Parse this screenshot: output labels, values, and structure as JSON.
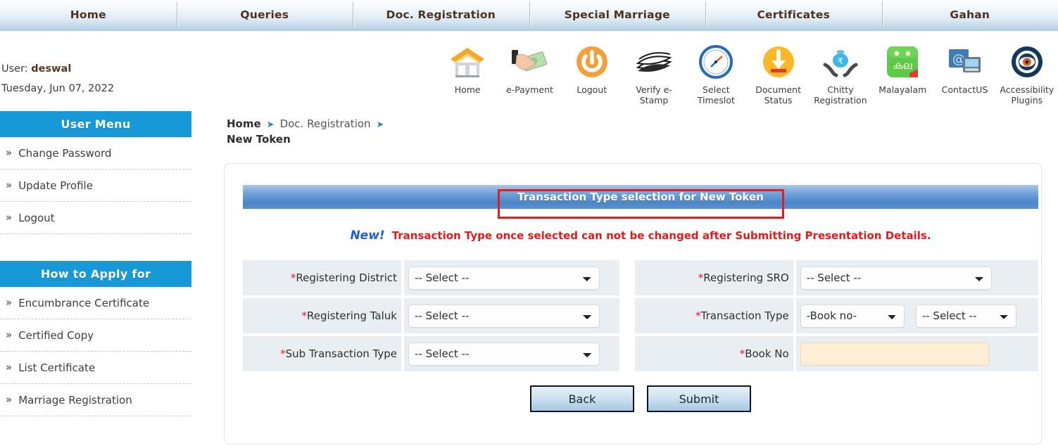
{
  "topnav": {
    "items": [
      {
        "label": "Home"
      },
      {
        "label": "Queries"
      },
      {
        "label": "Doc. Registration"
      },
      {
        "label": "Special Marriage"
      },
      {
        "label": "Certificates"
      },
      {
        "label": "Gahan"
      }
    ]
  },
  "user": {
    "prefix": "User:",
    "name": "deswal",
    "date": "Tuesday, Jun 07, 2022"
  },
  "sidebar": {
    "user_menu_title": "User Menu",
    "user_menu_items": [
      {
        "label": "Change Password"
      },
      {
        "label": "Update Profile"
      },
      {
        "label": "Logout"
      }
    ],
    "apply_title": "How to Apply for",
    "apply_items": [
      {
        "label": "Encumbrance Certificate"
      },
      {
        "label": "Certified Copy"
      },
      {
        "label": "List Certificate"
      },
      {
        "label": "Marriage Registration"
      }
    ]
  },
  "iconbar": {
    "items": [
      {
        "label": "Home",
        "icon": "house-icon"
      },
      {
        "label": "e-Payment",
        "icon": "hand-cash-icon"
      },
      {
        "label": "Logout",
        "icon": "power-icon"
      },
      {
        "label": "Verify e-Stamp",
        "icon": "stack-paper-icon"
      },
      {
        "label": "Select Timeslot",
        "icon": "clock-icon"
      },
      {
        "label": "Document Status",
        "icon": "download-circle-icon"
      },
      {
        "label": "Chitty Registration",
        "icon": "money-bag-hands-icon"
      },
      {
        "label": "Malayalam",
        "icon": "malayalam-app-icon"
      },
      {
        "label": "ContactUS",
        "icon": "at-mail-icon"
      },
      {
        "label": "Accessibility Plugins",
        "icon": "eye-target-icon"
      }
    ]
  },
  "breadcrumb": {
    "home": "Home",
    "section": "Doc.  Registration",
    "current": "New Token",
    "arrow": "➤"
  },
  "panel": {
    "header_title": "Transaction Type selection for New Token",
    "notice_new": "New!",
    "notice_message": "Transaction Type once selected can not be changed after Submitting Presentation Details.",
    "fields": {
      "registering_district": {
        "label": "Registering District",
        "required": "*",
        "value": "-- Select --",
        "options": [
          "-- Select --"
        ]
      },
      "registering_sro": {
        "label": "Registering SRO",
        "required": "*",
        "value": "-- Select --",
        "options": [
          "-- Select --"
        ]
      },
      "registering_taluk": {
        "label": "Registering Taluk",
        "required": "*",
        "value": "-- Select --",
        "options": [
          "-- Select --"
        ]
      },
      "transaction_type": {
        "label": "Transaction Type",
        "required": "*",
        "book_value": "-Book no-",
        "book_options": [
          "-Book no-"
        ],
        "type_value": "-- Select --",
        "type_options": [
          "-- Select --"
        ]
      },
      "sub_transaction_type": {
        "label": "Sub Transaction Type",
        "required": "*",
        "value": "-- Select --",
        "options": [
          "-- Select --"
        ]
      },
      "book_no": {
        "label": "Book No",
        "required": "*",
        "value": "",
        "placeholder": ""
      }
    },
    "buttons": {
      "back": "Back",
      "submit": "Submit"
    }
  },
  "colors": {
    "nav_text": "#4a3322",
    "sidebar_header": "#1799d8",
    "panel_header_blue": "#4b85c8",
    "highlight_red": "#e81b1b",
    "notice_red": "#e01c1c",
    "notice_blue": "#1e5fd6",
    "required_red": "#e02020",
    "input_amber": "#fdeed5"
  }
}
